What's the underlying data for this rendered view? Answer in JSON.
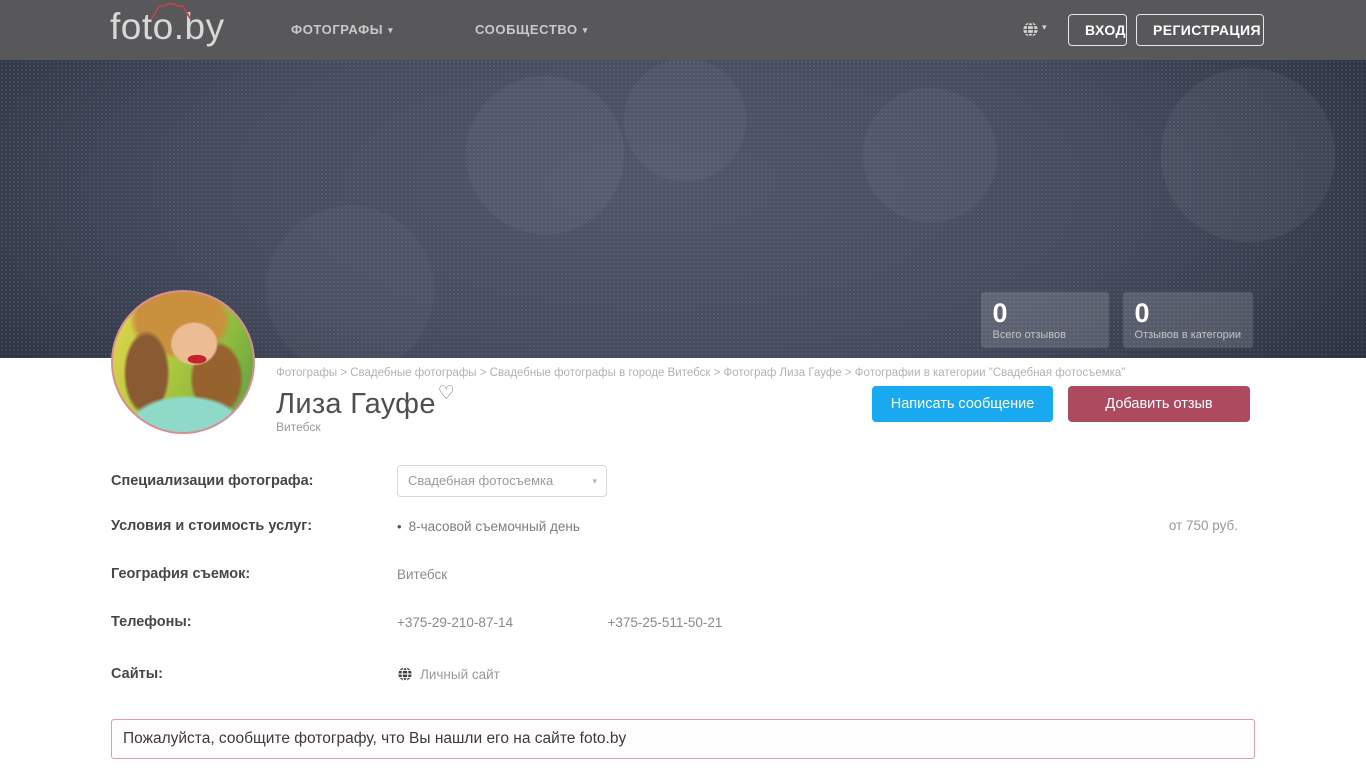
{
  "navbar": {
    "logo_text": "foto.by",
    "items": [
      {
        "label": "ФОТОГРАФЫ"
      },
      {
        "label": "СООБЩЕСТВО"
      }
    ],
    "login_label": "ВХОД",
    "register_label": "РЕГИСТРАЦИЯ"
  },
  "icons": {
    "caret": "▾",
    "heart": "♡",
    "bullet": "•"
  },
  "hero": {
    "stats": [
      {
        "value": "0",
        "label": "Всего отзывов"
      },
      {
        "value": "0",
        "label": "Отзывов в категории"
      }
    ]
  },
  "profile": {
    "breadcrumb": "Фотографы > Свадебные фотографы > Свадебные фотографы в городе Витебск > Фотограф Лиза Гауфе > Фотографии в категории \"Свадебная фотосъемка\"",
    "name": "Лиза Гауфе",
    "city": "Витебск",
    "message_button": "Написать сообщение",
    "review_button": "Добавить отзыв"
  },
  "details": {
    "specializations_label": "Специализации фотографа:",
    "specialization_selected": "Свадебная фотосъемка",
    "pricing_label": "Условия и стоимость услуг:",
    "pricing_item": "8-часовой съемочный день",
    "pricing_value": "от 750 руб.",
    "geography_label": "География съемок:",
    "geography_value": "Витебск",
    "phones_label": "Телефоны:",
    "phones": [
      "+375-29-210-87-14",
      "+375-25-511-50-21"
    ],
    "sites_label": "Сайты:",
    "site_link": "Личный сайт"
  },
  "notice_text": "Пожалуйста, сообщите фотографу, что Вы нашли его на сайте foto.by",
  "colors": {
    "navbar_bg": "#58585a",
    "hero_center": "#4f5669",
    "hero_edge": "#272d3b",
    "accent_blue": "#18a9f1",
    "accent_maroon": "#ae4a5f",
    "logo_camera_red": "#b5464a",
    "notice_border": "#e39ba4"
  }
}
